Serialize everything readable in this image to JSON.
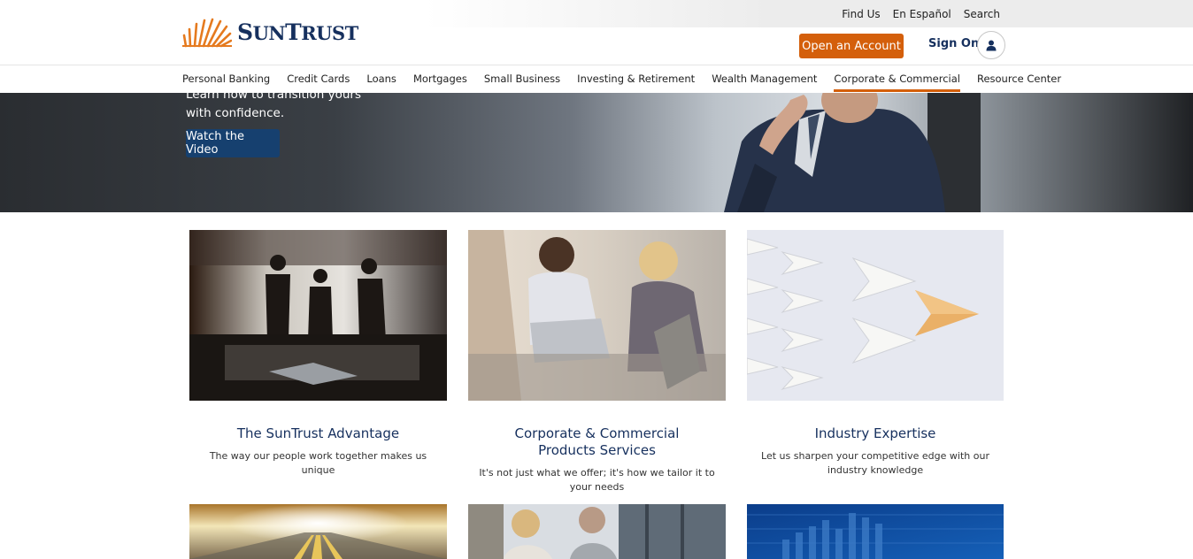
{
  "brand": {
    "name_big1": "S",
    "name_small1": "UN",
    "name_big2": "T",
    "name_small2": "RUST",
    "accent": "#d45f0b",
    "navy": "#16305e"
  },
  "utility_nav": [
    "Find Us",
    "En Español",
    "Search"
  ],
  "header": {
    "open_account": "Open an Account",
    "sign_on": "Sign On",
    "user_icon": "user-icon"
  },
  "main_nav": [
    "Personal Banking",
    "Credit Cards",
    "Loans",
    "Mortgages",
    "Small Business",
    "Investing & Retirement",
    "Wealth Management",
    "Corporate & Commercial",
    "Resource Center"
  ],
  "main_nav_active": "Corporate & Commercial",
  "hero": {
    "line1": "Learn how to transition yours",
    "line2": "with confidence.",
    "button": "Watch the Video"
  },
  "cards": [
    {
      "title": "The SunTrust Advantage",
      "title2": "",
      "desc": "The way our people work together makes us unique"
    },
    {
      "title": "Corporate & Commercial",
      "title2": "Products Services",
      "desc": "It's not just what we offer; it's how we tailor it to your needs"
    },
    {
      "title": "Industry Expertise",
      "title2": "",
      "desc": "Let us sharpen your competitive edge with our industry knowledge"
    }
  ]
}
